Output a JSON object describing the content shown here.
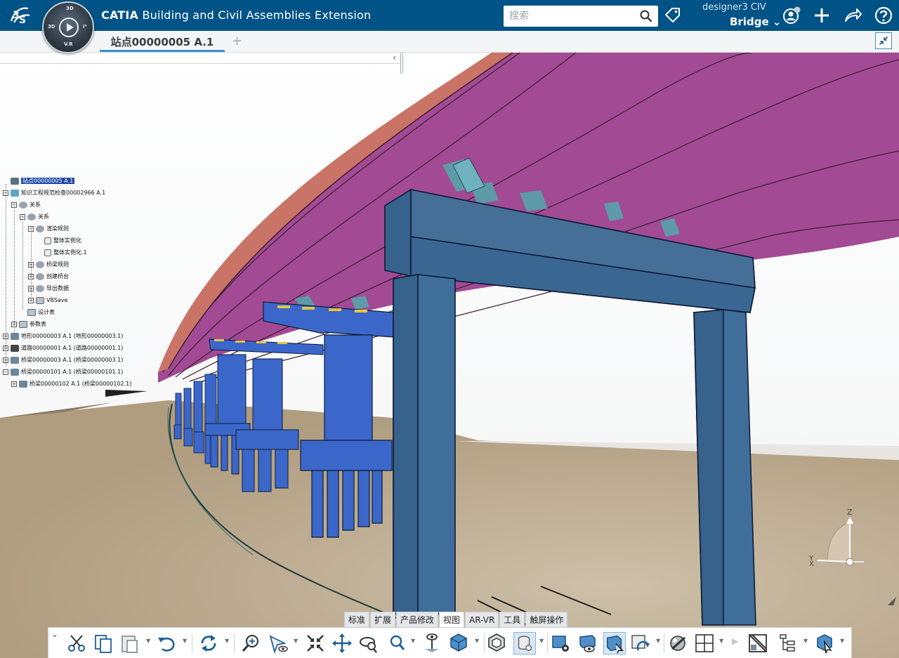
{
  "header": {
    "brand": "CATIA",
    "app_name": "Building and Civil Assemblies Extension",
    "search_placeholder": "搜索",
    "user": "designer3 CIV",
    "collab_space": "Bridge ⌄"
  },
  "tabs": {
    "active": "站点00000005 A.1",
    "add": "+"
  },
  "compass": {
    "top": "3D",
    "left": "3D",
    "right": "i³",
    "bottom": "V.R"
  },
  "tree": {
    "nodes": [
      {
        "label": "站点00000005 A.1",
        "level": 0,
        "icon": "root",
        "pm": "",
        "selected": true
      },
      {
        "label": "知识工程规范检查00002966 A.1",
        "level": 0,
        "icon": "kw",
        "pm": "−"
      },
      {
        "label": "关系",
        "level": 1,
        "icon": "gear",
        "pm": "−"
      },
      {
        "label": "关系",
        "level": 2,
        "icon": "gear",
        "pm": "−"
      },
      {
        "label": "渲染规则",
        "level": 3,
        "icon": "gear",
        "pm": "−"
      },
      {
        "label": "整体实例化",
        "level": 4,
        "icon": "doc",
        "pm": ""
      },
      {
        "label": "整体实例化.1",
        "level": 4,
        "icon": "doc",
        "pm": ""
      },
      {
        "label": "桥梁规则",
        "level": 3,
        "icon": "gear",
        "pm": "+"
      },
      {
        "label": "创建桥台",
        "level": 3,
        "icon": "gear",
        "pm": "+"
      },
      {
        "label": "导出数据",
        "level": 3,
        "icon": "gear",
        "pm": "+"
      },
      {
        "label": "VBSave",
        "level": 3,
        "icon": "tbl",
        "pm": "+"
      },
      {
        "label": "设计表",
        "level": 2,
        "icon": "tbl",
        "pm": ""
      },
      {
        "label": "参数表",
        "level": 1,
        "icon": "tbl",
        "pm": "+"
      },
      {
        "label": "地形00000003 A.1 (地形00000003.1)",
        "level": 0,
        "icon": "prd",
        "pm": "+"
      },
      {
        "label": "道路00000001 A.1 (道路00000001.1)",
        "level": 0,
        "icon": "align",
        "pm": "+"
      },
      {
        "label": "桥梁00000003 A.1 (桥梁00000003.1)",
        "level": 0,
        "icon": "prd",
        "pm": "+"
      },
      {
        "label": "桥梁00000101 A.1 (桥梁00000101.1)",
        "level": 0,
        "icon": "prd",
        "pm": "−"
      },
      {
        "label": "桥梁00000102 A.1 (桥梁00000102.1)",
        "level": 1,
        "icon": "prd",
        "pm": "+"
      }
    ]
  },
  "axis": {
    "z": "Z",
    "x": "X",
    "y": "Y"
  },
  "section_tabs": [
    "标准",
    "扩展",
    "产品修改",
    "视图",
    "AR-VR",
    "工具",
    "触屏操作"
  ],
  "active_section": "视图",
  "colors": {
    "header_bg": "#005386",
    "girder": "#a24a93",
    "deck_edge": "#c97466",
    "pier": "#3f6e9a",
    "pier_bright": "#3a67c9",
    "ground": "#b6a58c",
    "tab_underline": "#3d8fd0"
  },
  "toolbar_icons": [
    "cut-icon",
    "copy-icon",
    "paste-icon",
    "undo-icon",
    "update-icon",
    "zoom-area-icon",
    "fly-icon",
    "fit-all-icon",
    "pan-icon",
    "rotate-icon",
    "zoom-icon",
    "normal-view-icon",
    "iso-view-icon",
    "render-style-icon",
    "hide-show-icon",
    "view-mode-icon",
    "visualization-icon",
    "section-icon",
    "ambiance-icon",
    "split-view-icon",
    "capture-icon",
    "tree-icon",
    "assembly-icon"
  ]
}
